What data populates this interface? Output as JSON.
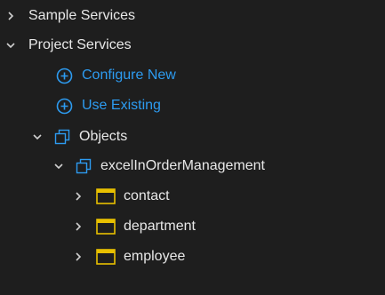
{
  "colors": {
    "background": "#1e1e1e",
    "text": "#e8e8e8",
    "action": "#2d9bf0",
    "object_icon": "#2d9bf0",
    "table_icon": "#e8c000",
    "chevron": "#cfcfcf"
  },
  "tree": {
    "sample_services": {
      "label": "Sample Services",
      "expanded": false,
      "icon": "chevron-right-icon"
    },
    "project_services": {
      "label": "Project Services",
      "expanded": true,
      "icon": "chevron-down-icon",
      "actions": [
        {
          "label": "Configure New",
          "icon": "plus-circle-icon"
        },
        {
          "label": "Use Existing",
          "icon": "plus-circle-icon"
        }
      ],
      "objects": {
        "label": "Objects",
        "expanded": true,
        "icon": "objects-icon",
        "service": {
          "label": "excelInOrderManagement",
          "expanded": true,
          "icon": "objects-icon",
          "tables": [
            {
              "label": "contact",
              "icon": "table-icon"
            },
            {
              "label": "department",
              "icon": "table-icon"
            },
            {
              "label": "employee",
              "icon": "table-icon"
            }
          ]
        }
      }
    }
  }
}
